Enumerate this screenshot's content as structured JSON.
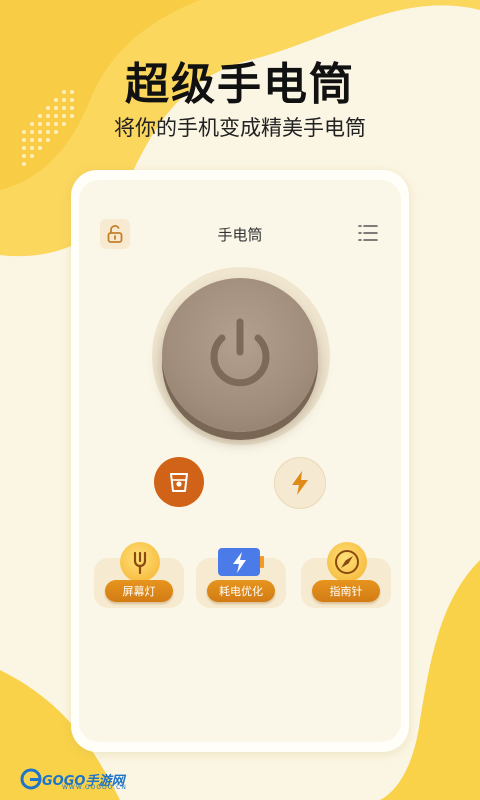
{
  "hero": {
    "title": "超级手电筒",
    "subtitle": "将你的手机变成精美手电筒"
  },
  "app": {
    "title": "手电筒",
    "lock_icon": "unlock-icon",
    "menu_icon": "list-menu-icon"
  },
  "controls": {
    "power_icon": "power-icon",
    "cup_icon": "cup-icon",
    "flash_icon": "lightning-icon"
  },
  "tools": [
    {
      "label": "屏幕灯",
      "icon": "lamp-icon"
    },
    {
      "label": "耗电优化",
      "icon": "battery-icon"
    },
    {
      "label": "指南针",
      "icon": "compass-icon"
    }
  ],
  "watermark": {
    "brand": "GOGO手游网",
    "url": "WWW.GOGOO.CN"
  },
  "colors": {
    "accent": "#d16318",
    "background": "#fbf6e4",
    "yellow": "#f9cf3c",
    "power": "#a18d7b"
  }
}
